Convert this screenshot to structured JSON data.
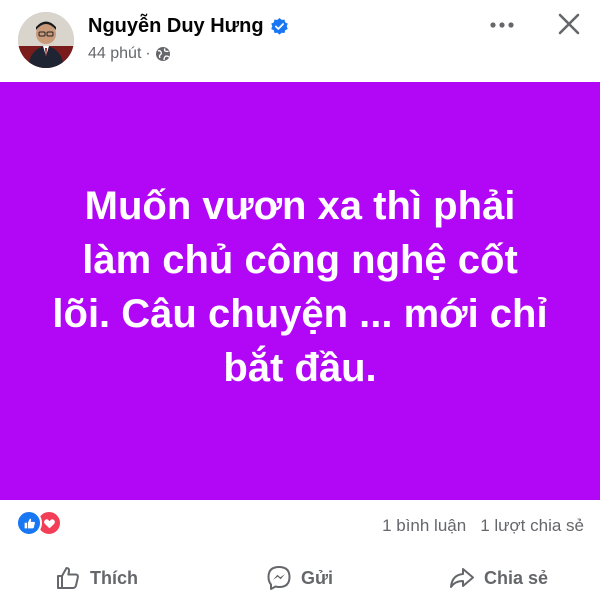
{
  "post": {
    "author_name": "Nguyễn Duy Hưng",
    "time": "44 phút",
    "dot": "·",
    "text": "Muốn vươn xa thì phải làm chủ công nghệ cốt lõi. Câu chuyện ... mới chỉ bắt đầu.",
    "background_color": "#b207f7",
    "icons": [
      "avatar",
      "verified-badge-icon",
      "globe-icon",
      "more-options-icon",
      "close-icon"
    ]
  },
  "engagement": {
    "reactions": [
      "like-reaction-icon",
      "love-reaction-icon"
    ],
    "comments": "1 bình luận",
    "shares": "1 lượt chia sẻ"
  },
  "actions": {
    "like": "Thích",
    "send": "Gửi",
    "share": "Chia sẻ"
  }
}
